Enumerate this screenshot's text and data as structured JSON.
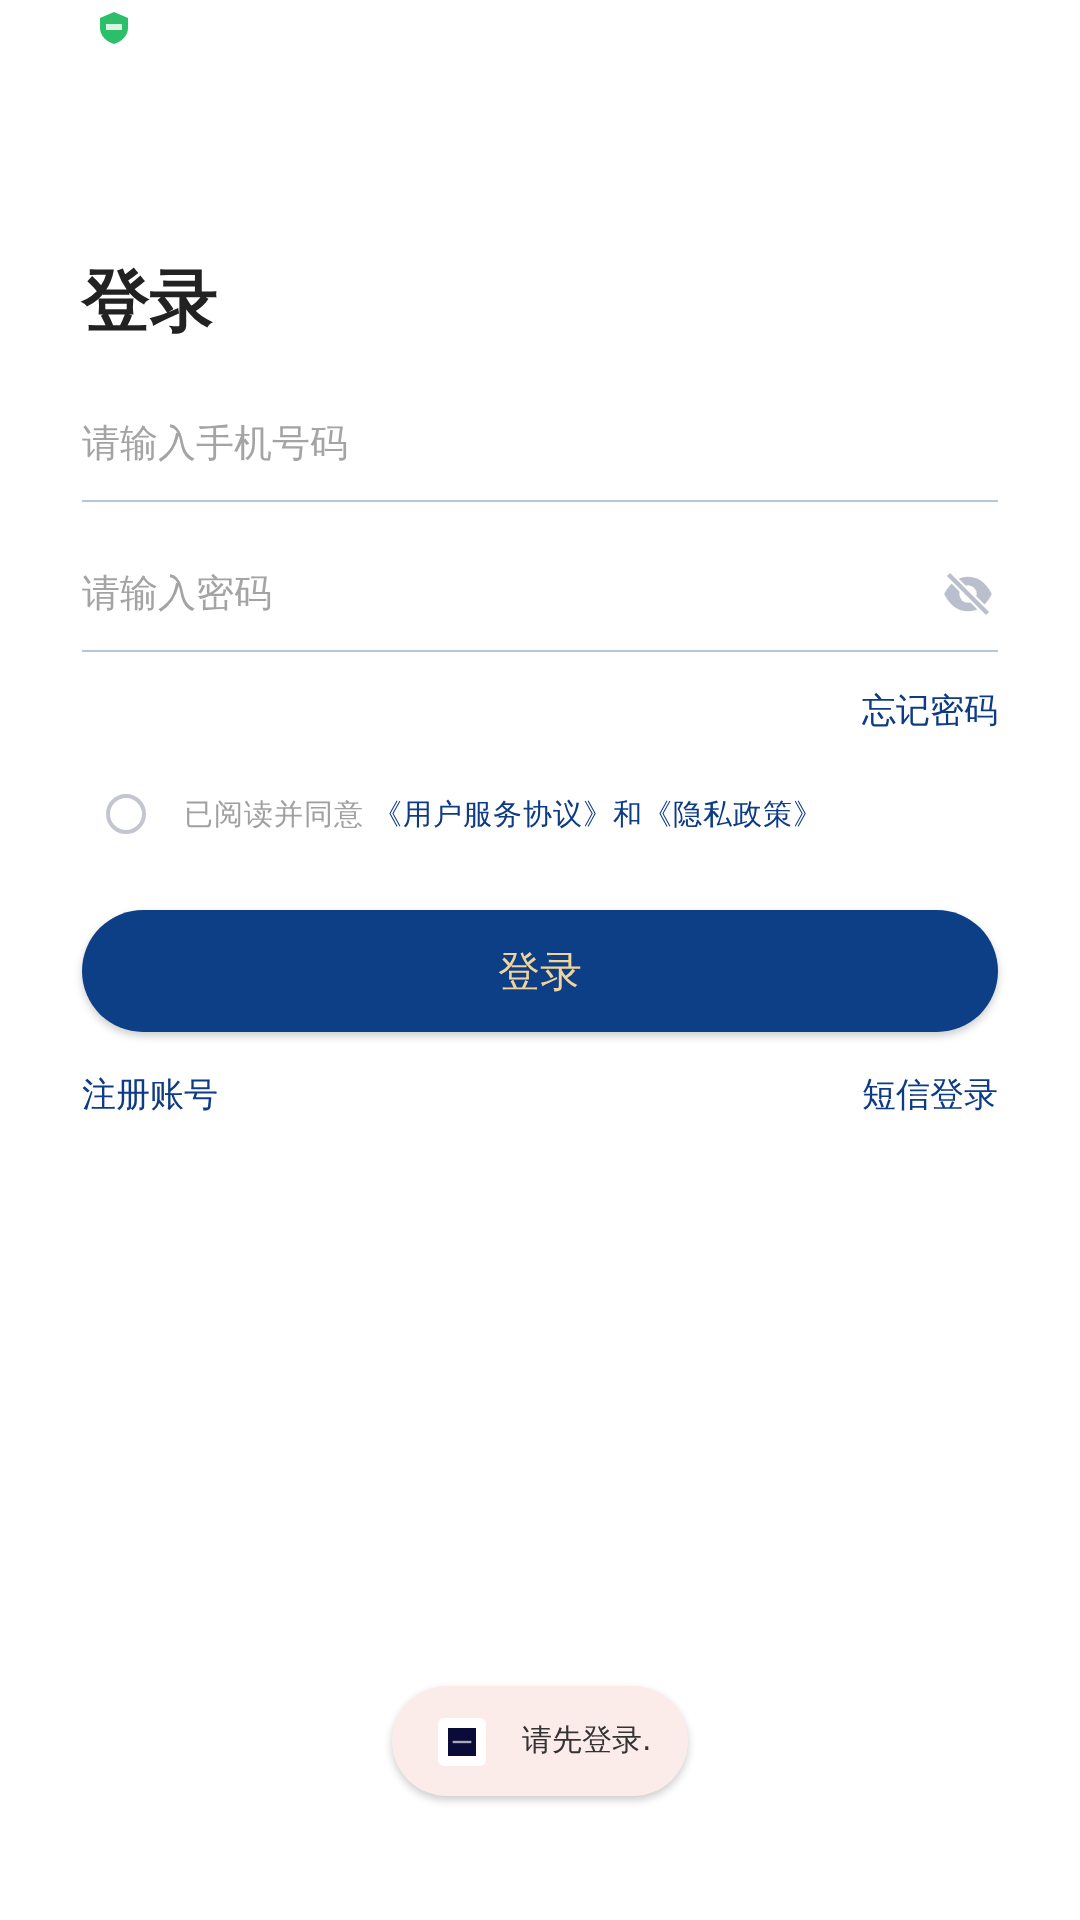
{
  "title": "登录",
  "fields": [
    {
      "placeholder": "请输入手机号码"
    },
    {
      "placeholder": "请输入密码",
      "password_visible": false
    }
  ],
  "forgot_link": "忘记密码",
  "agreement": {
    "checked": false,
    "parts": [
      {
        "kind": "text",
        "text": "已阅读并同意 "
      },
      {
        "kind": "link",
        "text": "《用户服务协议》"
      },
      {
        "kind": "joiner",
        "text": "和"
      },
      {
        "kind": "link",
        "text": "《隐私政策》"
      }
    ]
  },
  "login_button": "登录",
  "bottom_links": [
    "注册账号",
    "短信登录"
  ],
  "toast": {
    "message": "请先登录."
  }
}
